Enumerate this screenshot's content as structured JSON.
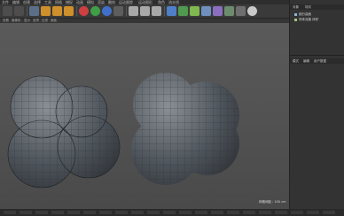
{
  "menubar": {
    "items": [
      "文件",
      "编辑",
      "创建",
      "选择",
      "工具",
      "网格",
      "捕捉",
      "动画",
      "模拟",
      "渲染",
      "雕刻",
      "运动跟踪",
      "运动图形",
      "角色",
      "流水线"
    ]
  },
  "toolbar": {
    "icons": [
      "undo-icon",
      "redo-icon",
      "live-select-icon",
      "move-icon",
      "scale-icon",
      "rotate-icon",
      "x-axis-icon",
      "y-axis-icon",
      "z-axis-icon",
      "coordinate-icon",
      "render-view-icon",
      "render-picture-icon",
      "render-settings-icon",
      "cube-icon",
      "pen-icon",
      "subdivide-icon",
      "array-icon",
      "deformer-icon",
      "floor-icon",
      "camera-icon",
      "light-icon"
    ]
  },
  "viewport_menu": {
    "items": [
      "查看",
      "摄像机",
      "显示",
      "选项",
      "过滤",
      "面板"
    ]
  },
  "object_manager": {
    "tabs": [
      "对象",
      "场次"
    ],
    "items": [
      {
        "name": "细分曲面"
      },
      {
        "name": "球体克隆",
        "sub": "体积"
      }
    ]
  },
  "attribute_manager": {
    "tabs": [
      "模式",
      "编辑",
      "用户数据"
    ]
  },
  "hud": {
    "text": "网格间距 : 100 cm"
  },
  "colors": {
    "accent": "#8fb0d8",
    "panel": "#333333",
    "viewport": "#565656"
  }
}
